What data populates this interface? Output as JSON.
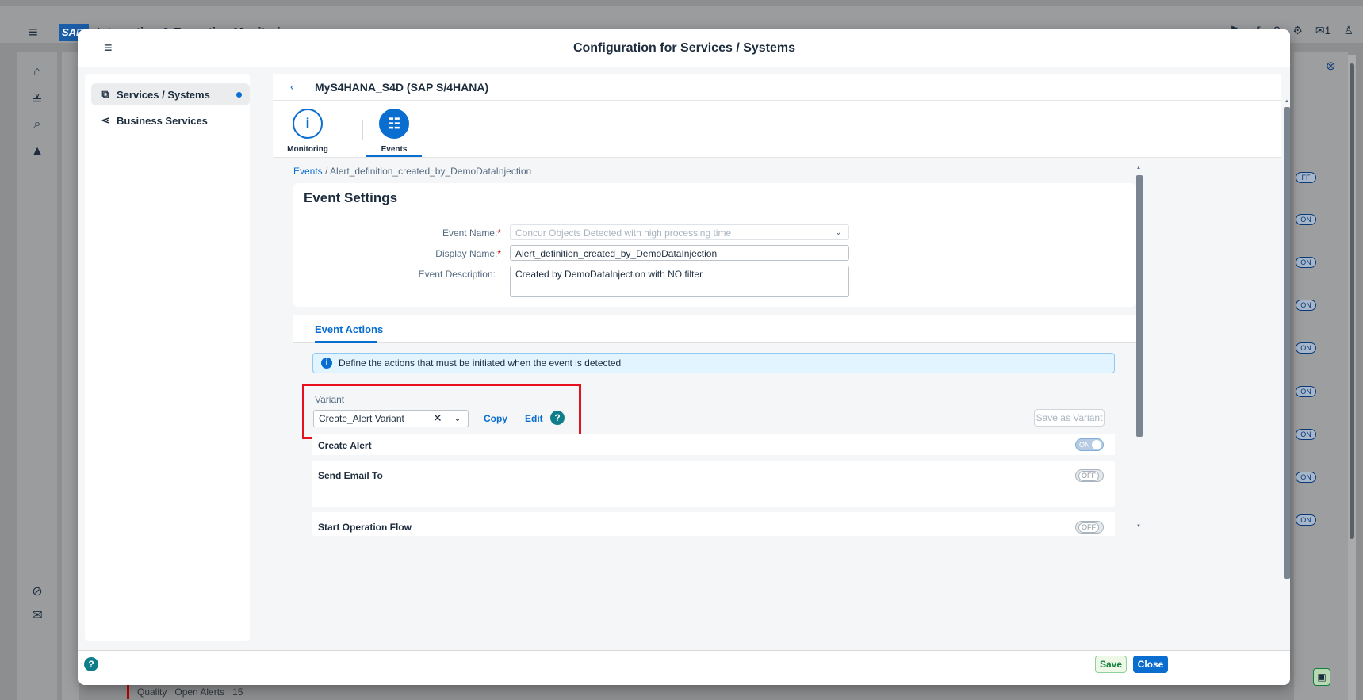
{
  "shell": {
    "menu_icon": "menu-icon",
    "logo": "SAP",
    "title": "Integration & Exception Monitoring",
    "notification_count": "1",
    "bottom_quality": "Quality",
    "bottom_open_alerts": "Open Alerts",
    "bottom_open_alerts_count": "15",
    "bg_toggles": [
      "FF",
      "ON",
      "ON",
      "ON",
      "ON",
      "ON",
      "ON",
      "ON",
      "ON"
    ]
  },
  "dialog": {
    "title": "Configuration for Services / Systems",
    "menu_icon": "menu-icon"
  },
  "leftnav": {
    "items": [
      {
        "label": "Services / Systems",
        "icon": "systems-icon",
        "selected": true
      },
      {
        "label": "Business Services",
        "icon": "share-icon",
        "selected": false
      }
    ]
  },
  "object": {
    "title": "MyS4HANA_S4D (SAP S/4HANA)",
    "tabs": [
      {
        "label": "Monitoring",
        "icon": "info-icon"
      },
      {
        "label": "Events",
        "icon": "event-list-icon"
      }
    ]
  },
  "breadcrumb": {
    "link": "Events",
    "separator": " / ",
    "current": "Alert_definition_created_by_DemoDataInjection"
  },
  "settings": {
    "title": "Event Settings",
    "event_name_label": "Event Name:",
    "event_name_value": "Concur Objects Detected with high processing time",
    "display_name_label": "Display Name:",
    "display_name_value": "Alert_definition_created_by_DemoDataInjection",
    "description_label": "Event Description:",
    "description_value": "Created by DemoDataInjection with NO filter",
    "required_marker": "*"
  },
  "actions": {
    "tab_label": "Event Actions",
    "info_text": "Define the actions that must be initiated when the event is detected",
    "variant_label": "Variant",
    "variant_value": "Create_Alert Variant",
    "copy_label": "Copy",
    "edit_label": "Edit",
    "help_glyph": "?",
    "save_as_variant_label": "Save as Variant",
    "rows": [
      {
        "title": "Create Alert",
        "state": "ON"
      },
      {
        "title": "Send Email To",
        "state": "OFF"
      },
      {
        "title": "Start Operation Flow",
        "state": "OFF"
      }
    ]
  },
  "footer": {
    "help_glyph": "?",
    "save_label": "Save",
    "close_label": "Close"
  },
  "colors": {
    "accent": "#0a6ed1",
    "highlight": "#e8101e",
    "help": "#0f7d8a"
  }
}
